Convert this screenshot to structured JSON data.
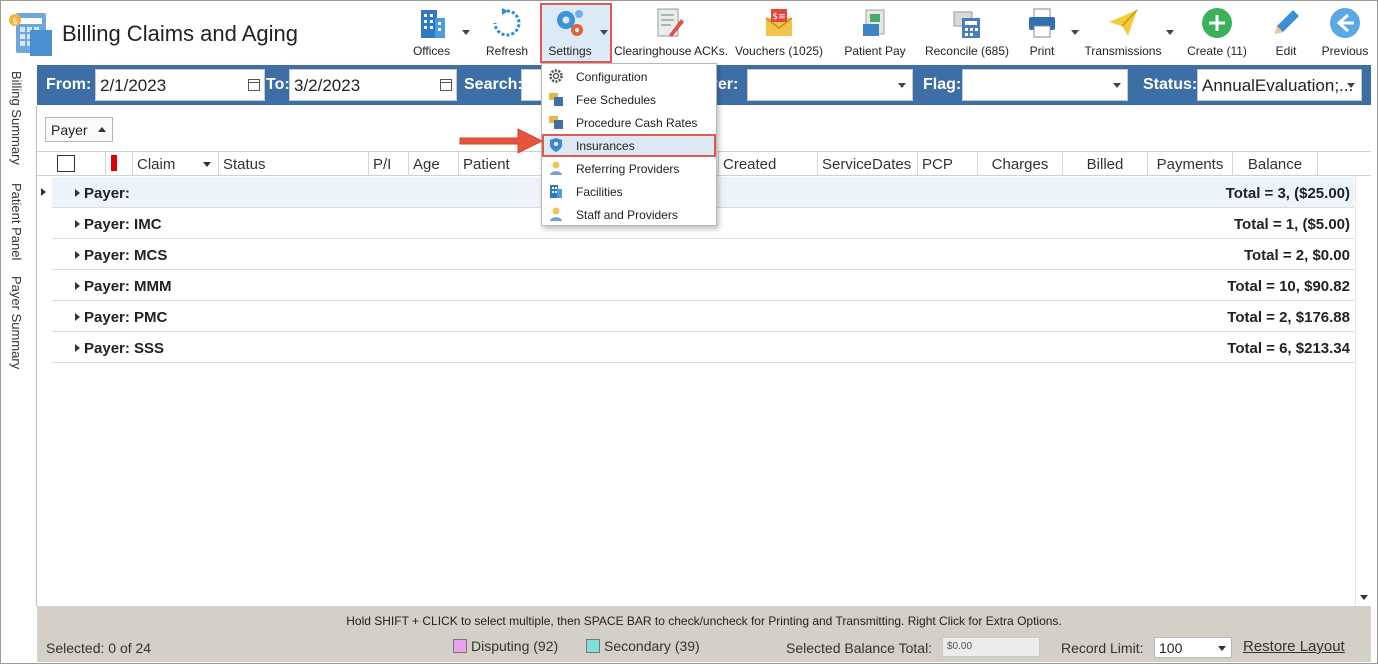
{
  "app": {
    "title": "Billing Claims and Aging"
  },
  "toolbar": {
    "offices": "Offices",
    "refresh": "Refresh",
    "settings": "Settings",
    "clearinghouse": "Clearinghouse ACKs.",
    "vouchers": "Vouchers (1025)",
    "patient_pay": "Patient Pay",
    "reconcile": "Reconcile (685)",
    "print": "Print",
    "transmissions": "Transmissions",
    "create": "Create (11)",
    "edit": "Edit",
    "previous": "Previous"
  },
  "filters": {
    "from_label": "From:",
    "from_value": "2/1/2023",
    "to_label": "To:",
    "to_value": "3/2/2023",
    "search_label": "Search:",
    "payer_label": "Payer:",
    "payer_label_visible": "yer:",
    "flag_label": "Flag:",
    "status_label": "Status:",
    "status_value": "AnnualEvaluation;..."
  },
  "side_tabs": [
    "Billing Summary",
    "Patient Panel",
    "Payer Summary"
  ],
  "group_by": {
    "label": "Payer"
  },
  "columns": {
    "claim": "Claim",
    "status": "Status",
    "pi": "P/I",
    "age": "Age",
    "patient": "Patient",
    "created": "Created",
    "service_dates": "ServiceDates",
    "pcp": "PCP",
    "charges": "Charges",
    "billed": "Billed",
    "payments": "Payments",
    "balance": "Balance"
  },
  "groups": [
    {
      "name": "Payer:",
      "total": "Total = 3,  ($25.00)"
    },
    {
      "name": "Payer: IMC",
      "total": "Total = 1,  ($5.00)"
    },
    {
      "name": "Payer: MCS",
      "total": "Total = 2,  $0.00"
    },
    {
      "name": "Payer: MMM",
      "total": "Total = 10,  $90.82"
    },
    {
      "name": "Payer: PMC",
      "total": "Total = 2,  $176.88"
    },
    {
      "name": "Payer: SSS",
      "total": "Total = 6,  $213.34"
    }
  ],
  "settings_menu": {
    "items": [
      {
        "label": "Configuration",
        "icon": "gear-icon"
      },
      {
        "label": "Fee Schedules",
        "icon": "fee-schedule-icon"
      },
      {
        "label": "Procedure Cash Rates",
        "icon": "cash-rates-icon"
      },
      {
        "label": "Insurances",
        "icon": "shield-icon"
      },
      {
        "label": "Referring Providers",
        "icon": "provider-icon"
      },
      {
        "label": "Facilities",
        "icon": "building-icon"
      },
      {
        "label": "Staff and Providers",
        "icon": "staff-icon"
      }
    ],
    "highlighted": "Insurances"
  },
  "footer": {
    "hint": "Hold SHIFT + CLICK to select multiple, then SPACE BAR to check/uncheck for Printing and Transmitting. Right Click for Extra Options.",
    "selected": "Selected: 0 of 24",
    "disputing": "Disputing (92)",
    "secondary": "Secondary (39)",
    "selected_balance_label": "Selected Balance Total:",
    "selected_balance_value": "$0.00",
    "record_limit_label": "Record Limit:",
    "record_limit_value": "100",
    "restore_layout": "Restore Layout"
  },
  "colors": {
    "filter_bar": "#3d6fa6",
    "highlight_border": "#e05a4f",
    "disputing": "#e9a3ee",
    "secondary": "#7fe0d8",
    "flag": "#e00000"
  }
}
